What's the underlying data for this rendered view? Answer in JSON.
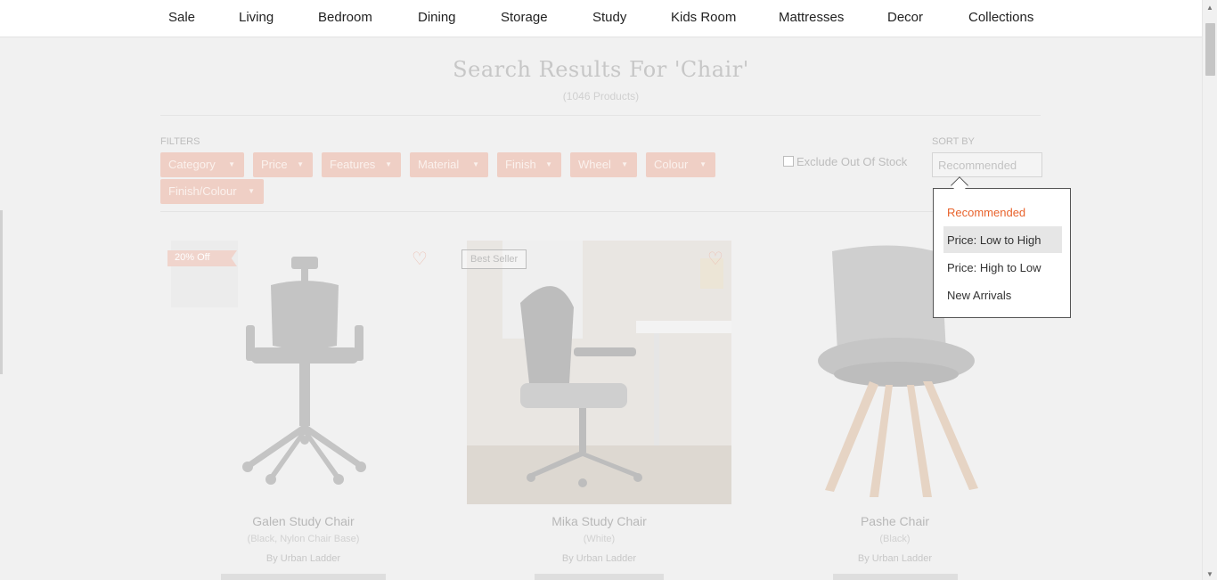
{
  "nav": {
    "items": [
      "Sale",
      "Living",
      "Bedroom",
      "Dining",
      "Storage",
      "Study",
      "Kids Room",
      "Mattresses",
      "Decor",
      "Collections"
    ]
  },
  "search": {
    "title": "Search Results For 'Chair'",
    "count": "(1046 Products)"
  },
  "filters": {
    "label": "FILTERS",
    "chips": [
      "Category",
      "Price",
      "Features",
      "Material",
      "Finish",
      "Wheel",
      "Colour",
      "Finish/Colour"
    ],
    "exclude_out_of_stock": "Exclude Out Of Stock"
  },
  "sort": {
    "label": "SORT BY",
    "selected": "Recommended",
    "options": [
      "Recommended",
      "Price: Low to High",
      "Price: High to Low",
      "New Arrivals"
    ]
  },
  "products": [
    {
      "name": "Galen Study Chair",
      "variant": "(Black, Nylon Chair Base)",
      "brand": "By Urban Ladder",
      "badge": "20% Off"
    },
    {
      "name": "Mika Study Chair",
      "variant": "(White)",
      "brand": "By Urban Ladder",
      "badge": "Best Seller"
    },
    {
      "name": "Pashe Chair",
      "variant": "(Black)",
      "brand": "By Urban Ladder",
      "badge": ""
    }
  ],
  "colors": {
    "accent": "#e8632c",
    "chip_bg": "#efcfc5",
    "overlay_bg": "#f1f1f1"
  }
}
